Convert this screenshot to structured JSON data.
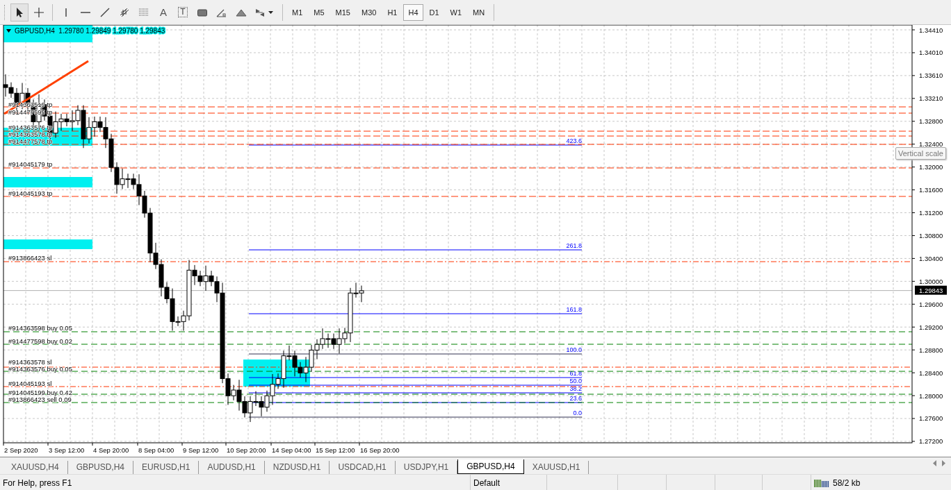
{
  "toolbar": {
    "text_tool": "A",
    "label_tool": "T",
    "timeframes": [
      {
        "label": "M1",
        "selected": false
      },
      {
        "label": "M5",
        "selected": false
      },
      {
        "label": "M15",
        "selected": false
      },
      {
        "label": "M30",
        "selected": false
      },
      {
        "label": "H1",
        "selected": false
      },
      {
        "label": "H4",
        "selected": true
      },
      {
        "label": "D1",
        "selected": false
      },
      {
        "label": "W1",
        "selected": false
      },
      {
        "label": "MN",
        "selected": false
      }
    ]
  },
  "chart": {
    "title": "GBPUSD,H4  1.29780 1.29849 1.29780 1.29843",
    "price_axis": [
      "1.34410",
      "1.34010",
      "1.33610",
      "1.33210",
      "1.32800",
      "1.32400",
      "1.32000",
      "1.31600",
      "1.31200",
      "1.30800",
      "1.30400",
      "1.30000",
      "1.29600",
      "1.29200",
      "1.28800",
      "1.28400",
      "1.28000",
      "1.27600",
      "1.27200"
    ],
    "current_price": "1.29843",
    "time_axis": [
      "2 Sep 2020",
      "3 Sep 12:00",
      "4 Sep 20:00",
      "8 Sep 04:00",
      "9 Sep 12:00",
      "10 Sep 20:00",
      "14 Sep 04:00",
      "15 Sep 12:00",
      "16 Sep 20:00"
    ],
    "order_lines": [
      {
        "label": "#914363519 tp",
        "kind": "tp"
      },
      {
        "label": "#914477595 tp",
        "kind": "tp"
      },
      {
        "label": "#914363576 tp",
        "kind": "tp"
      },
      {
        "label": "#914363578 tp",
        "kind": "tp"
      },
      {
        "label": "#914477578 tp",
        "kind": "tp"
      },
      {
        "label": "#914045179 tp",
        "kind": "tp"
      },
      {
        "label": "#914045193 tp",
        "kind": "tp"
      },
      {
        "label": "#913866423 sl",
        "kind": "sl"
      },
      {
        "label": "#914363598 buy 0.05",
        "kind": "buy"
      },
      {
        "label": "#914477598 buy 0.02",
        "kind": "buy"
      },
      {
        "label": "#914363578 sl",
        "kind": "sl"
      },
      {
        "label": "#914363576 buy 0.05",
        "kind": "buy"
      },
      {
        "label": "#914045193 sl",
        "kind": "sl"
      },
      {
        "label": "#914045199 buy 0.42",
        "kind": "buy"
      },
      {
        "label": "#913866423 sell 0.09",
        "kind": "sell"
      }
    ],
    "fib_levels": [
      "423.6",
      "261.8",
      "161.8",
      "100.0",
      "61.8",
      "50.0",
      "38.2",
      "23.6",
      "0.0"
    ],
    "tooltip": "Vertical scale"
  },
  "tabs": [
    {
      "label": "XAUUSD,H4",
      "selected": false
    },
    {
      "label": "GBPUSD,H4",
      "selected": false
    },
    {
      "label": "EURUSD,H1",
      "selected": false
    },
    {
      "label": "AUDUSD,H1",
      "selected": false
    },
    {
      "label": "NZDUSD,H1",
      "selected": false
    },
    {
      "label": "USDCAD,H1",
      "selected": false
    },
    {
      "label": "USDJPY,H1",
      "selected": false
    },
    {
      "label": "GBPUSD,H4",
      "selected": true
    },
    {
      "label": "XAUUSD,H1",
      "selected": false
    }
  ],
  "status_bar": {
    "help": "For Help, press F1",
    "profile": "Default",
    "traffic": "58/2 kb"
  }
}
